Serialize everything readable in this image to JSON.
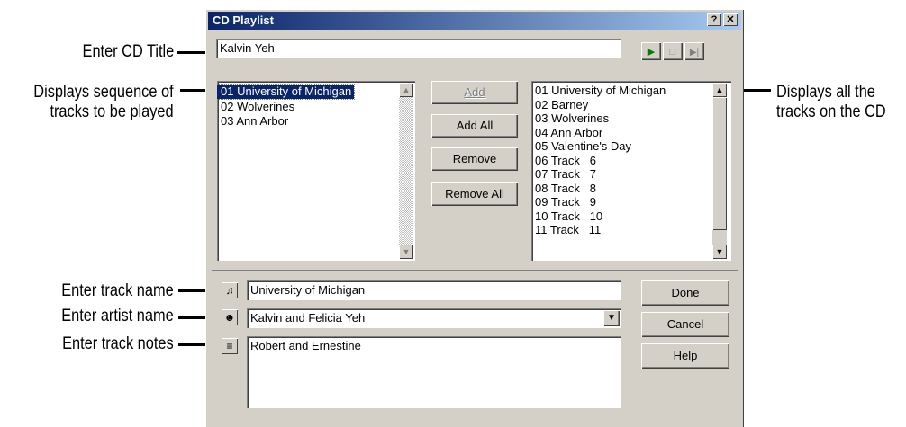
{
  "window": {
    "title": "CD Playlist",
    "help_btn": "?",
    "close_btn": "✕"
  },
  "cd_title": {
    "value": "Kalvin Yeh"
  },
  "transport": {
    "play": "▶",
    "stop": "□",
    "next": "▶|"
  },
  "playlist": {
    "items": [
      "01 University of Michigan",
      "02 Wolverines",
      "03 Ann Arbor"
    ]
  },
  "buttons": {
    "add": "Add",
    "add_all": "Add All",
    "remove": "Remove",
    "remove_all": "Remove All",
    "done": "Done",
    "cancel": "Cancel",
    "help": "Help"
  },
  "available": {
    "items": [
      "01 University of Michigan",
      "02 Barney",
      "03 Wolverines",
      "04 Ann Arbor",
      "05 Valentine's Day",
      "06 Track   6",
      "07 Track   7",
      "08 Track   8",
      "09 Track   9",
      "10 Track   10",
      "11 Track   11"
    ]
  },
  "track_name": {
    "value": "University of Michigan",
    "icon": "♫"
  },
  "artist_name": {
    "value": "Kalvin and Felicia Yeh",
    "icon": "☻"
  },
  "track_notes": {
    "value": "Robert and Ernestine",
    "icon": "≡"
  },
  "callouts": {
    "cd_title": "Enter CD Title",
    "sequence": "Displays sequence of\ntracks to be played",
    "all_tracks": "Displays all the\ntracks on the CD",
    "track_name": "Enter track name",
    "artist_name": "Enter artist name",
    "track_notes": "Enter track notes"
  }
}
